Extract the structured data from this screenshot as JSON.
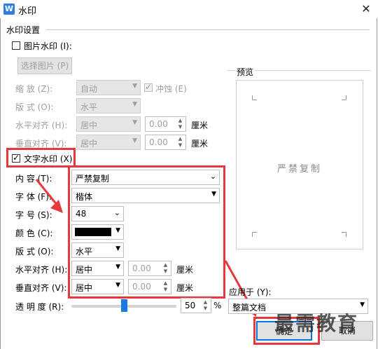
{
  "window": {
    "title": "水印",
    "icon_letter": "W",
    "close_glyph": "✕"
  },
  "section_title": "水印设置",
  "picture_watermark": {
    "label": "图片水印 (I):",
    "checked": false
  },
  "select_picture_button": "选择图片 (P)",
  "scale": {
    "label": "缩    放 (Z):",
    "value": "自动"
  },
  "washout": {
    "label": "冲蚀 (E)",
    "checked": true
  },
  "pic_layout": {
    "label": "版    式 (O):",
    "value": "水平"
  },
  "pic_halign": {
    "label": "水平对齐 (H):",
    "value": "居中",
    "offset": "0.00",
    "unit": "厘米"
  },
  "pic_valign": {
    "label": "垂直对齐 (V):",
    "value": "居中",
    "offset": "0.00",
    "unit": "厘米"
  },
  "text_watermark": {
    "label": "文字水印 (X)",
    "checked": true
  },
  "content": {
    "label": "内    容 (T):",
    "value": "严禁复制"
  },
  "font": {
    "label": "字    体 (F):",
    "value": "楷体"
  },
  "size": {
    "label": "字    号 (S):",
    "value": "48"
  },
  "color": {
    "label": "颜    色 (C):",
    "swatch": "#000000"
  },
  "text_layout": {
    "label": "版    式 (O):",
    "value": "水平"
  },
  "text_halign": {
    "label": "水平对齐 (H):",
    "value": "居中",
    "offset": "0.00",
    "unit": "厘米"
  },
  "text_valign": {
    "label": "垂直对齐 (V):",
    "value": "居中",
    "offset": "0.00",
    "unit": "厘米"
  },
  "transparency": {
    "label": "透 明 度 (R):",
    "value": "50",
    "unit": "%",
    "fraction": 0.5
  },
  "preview": {
    "label": "预览",
    "text": "严禁复制"
  },
  "apply_to": {
    "label": "应用于 (Y):",
    "value": "整篇文档"
  },
  "ok_button": "确定",
  "cancel_button": "取消",
  "watermark_overlay": "最需教育",
  "colors": {
    "highlight": "#e8383d",
    "icon": "#2f7de1",
    "slider_thumb": "#1a7ae0"
  }
}
